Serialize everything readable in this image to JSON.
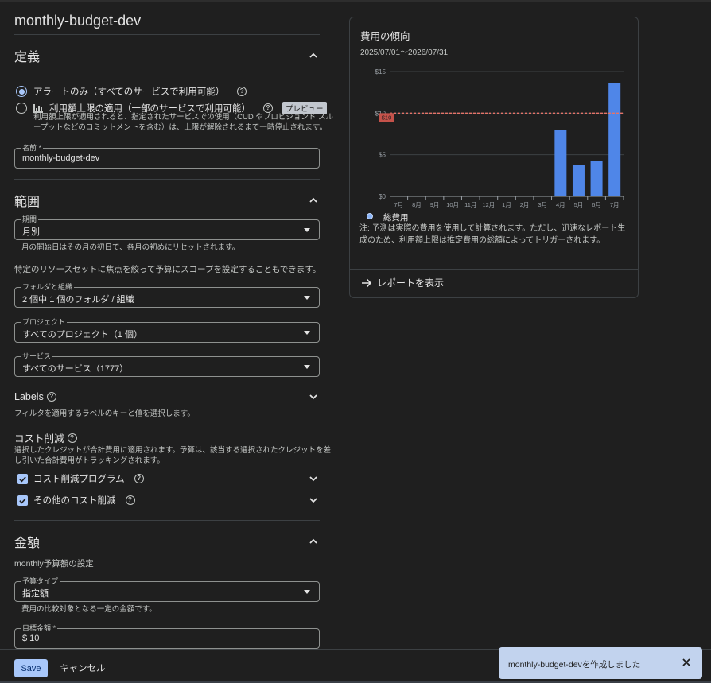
{
  "page": {
    "title": "monthly-budget-dev"
  },
  "definition": {
    "heading": "定義",
    "radio_alert": "アラートのみ（すべてのサービスで利用可能）",
    "radio_cap": "利用額上限の適用（一部のサービスで利用可能）",
    "preview_badge": "プレビュー",
    "cap_desc_1": "利用額上限が適用されると、指定されたサービスでの使用（CUD やプロビジョンド スル",
    "cap_desc_2": "ープットなどのコミットメントを含む）は、上限が解除されるまで一時停止されます。",
    "name_label": "名前 *",
    "name_value": "monthly-budget-dev"
  },
  "scope": {
    "heading": "範囲",
    "period_label": "期間",
    "period_value": "月別",
    "period_hint": "月の開始日はその月の初日で、各月の初めにリセットされます。",
    "scope_note": "特定のリソースセットに焦点を絞って予算にスコープを設定することもできます。",
    "folders_label": "フォルダと組織",
    "folders_value": "2 個中 1 個のフォルダ / 組織",
    "projects_label": "プロジェクト",
    "projects_value": "すべてのプロジェクト（1 個）",
    "services_label": "サービス",
    "services_value": "すべてのサービス（1777）",
    "labels_heading": "Labels",
    "labels_hint": "フィルタを適用するラベルのキーと値を選択します。",
    "credits_heading": "コスト削減",
    "credits_desc_1": "選択したクレジットが合計費用に適用されます。予算は、該当する選択されたクレジットを差",
    "credits_desc_2": "し引いた合計費用がトラッキングされます。",
    "credit_1": "コスト削減プログラム",
    "credit_2": "その他のコスト削減"
  },
  "amount": {
    "heading": "金額",
    "subtitle": "monthly予算額の設定",
    "type_label": "予算タイプ",
    "type_value": "指定額",
    "type_hint": "費用の比較対象となる一定の金額です。",
    "target_label": "目標金額 *",
    "target_value": "$ 10"
  },
  "footer": {
    "save": "Save",
    "cancel": "キャンセル"
  },
  "card": {
    "title": "費用の傾向",
    "range": "2025/07/01～2026/07/31",
    "legend": "総費用",
    "note": "注: 予測は実際の費用を使用して計算されます。ただし、迅速なレポート生成のため、利用額上限は推定費用の総額によってトリガーされます。",
    "report_link": "レポートを表示"
  },
  "chart_data": {
    "type": "bar",
    "categories": [
      "7月",
      "8月",
      "9月",
      "10月",
      "11月",
      "12月",
      "1月",
      "2月",
      "3月",
      "4月",
      "5月",
      "6月",
      "7月"
    ],
    "series": [
      {
        "name": "総費用",
        "values": [
          0,
          0,
          0,
          0,
          0,
          0,
          0,
          0,
          0,
          8.0,
          3.8,
          4.3,
          13.6
        ]
      }
    ],
    "yticks": [
      "$0",
      "$5",
      "$10",
      "$15"
    ],
    "ylim": [
      0,
      15
    ],
    "threshold": {
      "value": 10,
      "label": "$10"
    },
    "colors": {
      "bar": "#4f86e8",
      "threshold": "#e57368"
    }
  },
  "toast": {
    "message": "monthly-budget-devを作成しました"
  }
}
